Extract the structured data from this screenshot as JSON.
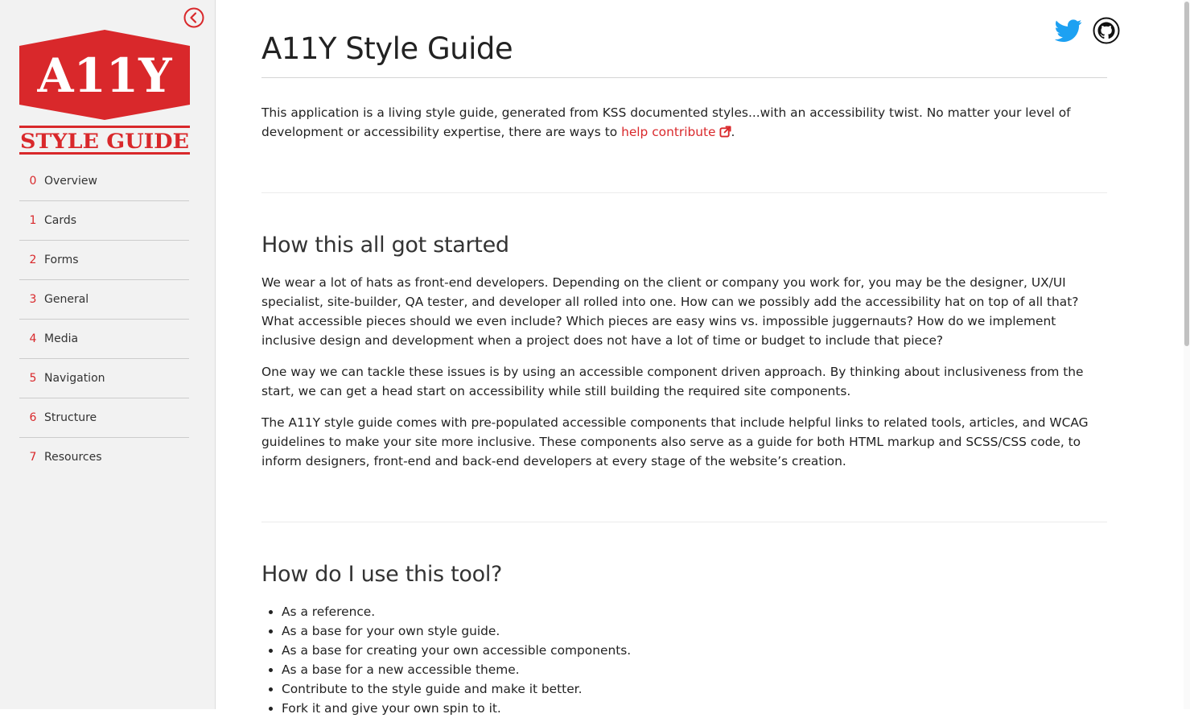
{
  "sidebar": {
    "logo": {
      "line1": "A11Y",
      "line2": "STYLE GUIDE"
    },
    "collapse_icon": "chevron-left-circle-icon",
    "nav": [
      {
        "num": "0",
        "label": "Overview"
      },
      {
        "num": "1",
        "label": "Cards"
      },
      {
        "num": "2",
        "label": "Forms"
      },
      {
        "num": "3",
        "label": "General"
      },
      {
        "num": "4",
        "label": "Media"
      },
      {
        "num": "5",
        "label": "Navigation"
      },
      {
        "num": "6",
        "label": "Structure"
      },
      {
        "num": "7",
        "label": "Resources"
      }
    ]
  },
  "header": {
    "title": "A11Y Style Guide",
    "social": [
      "twitter-icon",
      "github-icon"
    ]
  },
  "intro": {
    "text_before": "This application is a living style guide, generated from KSS documented styles...with an accessibility twist. No matter your level of development or accessibility expertise, there are ways to ",
    "link_label": "help contribute",
    "text_after": "."
  },
  "sections": [
    {
      "heading": "How this all got started",
      "paragraphs": [
        "We wear a lot of hats as front-end developers. Depending on the client or company you work for, you may be the designer, UX/UI specialist, site-builder, QA tester, and developer all rolled into one. How can we possibly add the accessibility hat on top of all that? What accessible pieces should we even include? Which pieces are easy wins vs. impossible juggernauts? How do we implement inclusive design and development when a project does not have a lot of time or budget to include that piece?",
        "One way we can tackle these issues is by using an accessible component driven approach. By thinking about inclusiveness from the start, we can get a head start on accessibility while still building the required site components.",
        "The A11Y style guide comes with pre-populated accessible components that include helpful links to related tools, articles, and WCAG guidelines to make your site more inclusive. These components also serve as a guide for both HTML markup and SCSS/CSS code, to inform designers, front-end and back-end developers at every stage of the website’s creation."
      ]
    },
    {
      "heading": "How do I use this tool?",
      "bullets": [
        "As a reference.",
        "As a base for your own style guide.",
        "As a base for creating your own accessible components.",
        "As a base for a new accessible theme.",
        "Contribute to the style guide and make it better.",
        "Fork it and give your own spin to it."
      ]
    }
  ],
  "colors": {
    "accent": "#d9282b",
    "sidebar_bg": "#f2f2f2",
    "twitter": "#1da1f2",
    "text": "#222222"
  }
}
